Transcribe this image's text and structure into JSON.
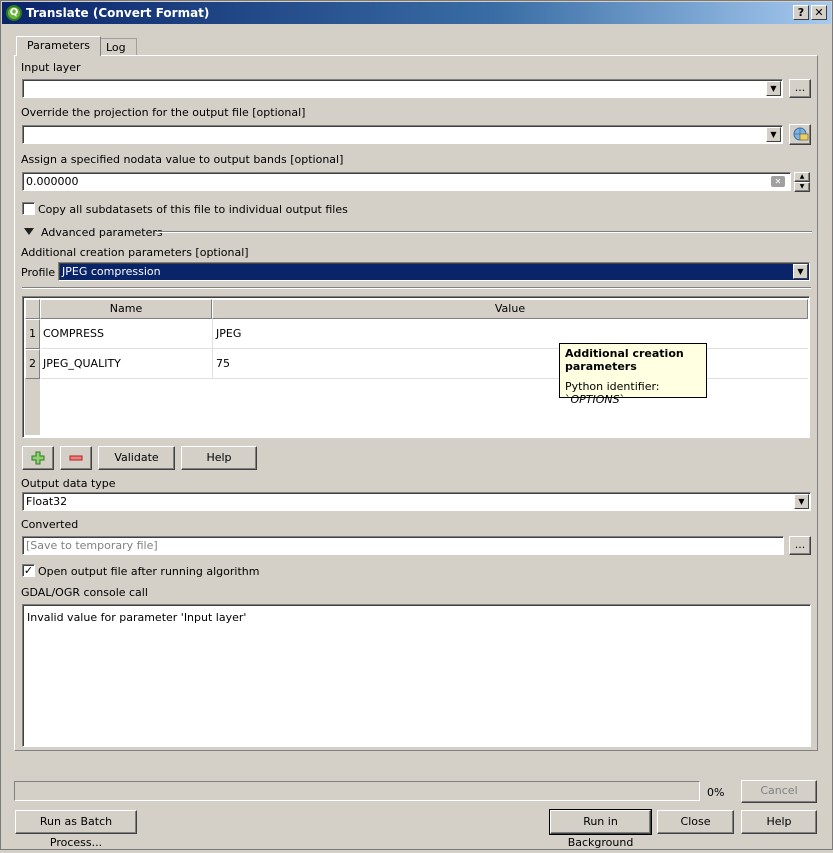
{
  "window": {
    "title": "Translate (Convert Format)",
    "help_btn": "?",
    "close_btn": "✕"
  },
  "tabs": [
    "Parameters",
    "Log"
  ],
  "params": {
    "input_layer_label": "Input layer",
    "input_layer_value": "",
    "browse": "...",
    "projection_label": "Override the projection for the output file [optional]",
    "projection_value": "",
    "nodata_label": "Assign a specified nodata value to output bands [optional]",
    "nodata_value": "0.000000",
    "copy_subdatasets_label": "Copy all subdatasets of this file to individual output files",
    "copy_subdatasets_checked": false,
    "advanced_label": "Advanced parameters",
    "creation_params_label": "Additional creation parameters [optional]",
    "profile_label": "Profile",
    "profile_value": "JPEG compression"
  },
  "table": {
    "columns": [
      "Name",
      "Value"
    ],
    "rows": [
      {
        "index": "1",
        "name": "COMPRESS",
        "value": "JPEG"
      },
      {
        "index": "2",
        "name": "JPEG_QUALITY",
        "value": "75"
      }
    ]
  },
  "tooltip": {
    "title": "Additional creation parameters",
    "identifier_prefix": "Python identifier: `",
    "identifier": "OPTIONS",
    "identifier_suffix": "`"
  },
  "table_buttons": {
    "add": "+",
    "remove": "−",
    "validate": "Validate",
    "help": "Help"
  },
  "output": {
    "data_type_label": "Output data type",
    "data_type_value": "Float32",
    "converted_label": "Converted",
    "converted_placeholder": "[Save to temporary file]",
    "open_after_label": "Open output file after running algorithm",
    "open_after_checked": true,
    "console_label": "GDAL/OGR console call",
    "console_text": "Invalid value for parameter 'Input layer'"
  },
  "footer": {
    "progress_percent": "0%",
    "progress_value": 0,
    "cancel": "Cancel",
    "batch": "Run as Batch Process...",
    "run_background": "Run in Background",
    "close": "Close",
    "help": "Help"
  },
  "colors": {
    "title_start": "#0a246a",
    "selection": "#0a246a",
    "tooltip_bg": "#ffffe1"
  },
  "icons": [
    "qgis-logo-icon",
    "help-icon",
    "close-icon",
    "dropdown-arrow-icon",
    "crs-globe-icon",
    "clear-icon",
    "spin-up-icon",
    "spin-down-icon",
    "expand-triangle-icon",
    "add-icon",
    "remove-icon"
  ]
}
